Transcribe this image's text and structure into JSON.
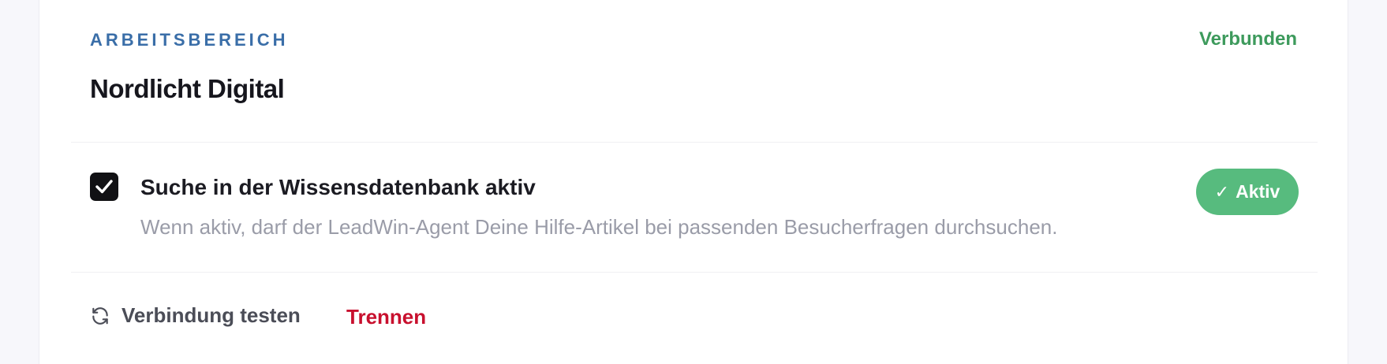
{
  "workspace": {
    "section_label": "ARBEITSBEREICH",
    "name": "Nordlicht Digital",
    "status": "Verbunden",
    "status_color": "#3d9a5c"
  },
  "knowledge_search": {
    "checked": true,
    "title": "Suche in der Wissensdatenbank aktiv",
    "description": "Wenn aktiv, darf der LeadWin-Agent Deine Hilfe-Artikel bei passenden Besucherfragen durchsuchen.",
    "badge_check": "✓",
    "badge_label": "Aktiv",
    "badge_color": "#57bb7e"
  },
  "actions": {
    "test_icon": "refresh-icon",
    "test_label": "Verbindung testen",
    "disconnect_label": "Trennen",
    "disconnect_color": "#c8102e"
  }
}
